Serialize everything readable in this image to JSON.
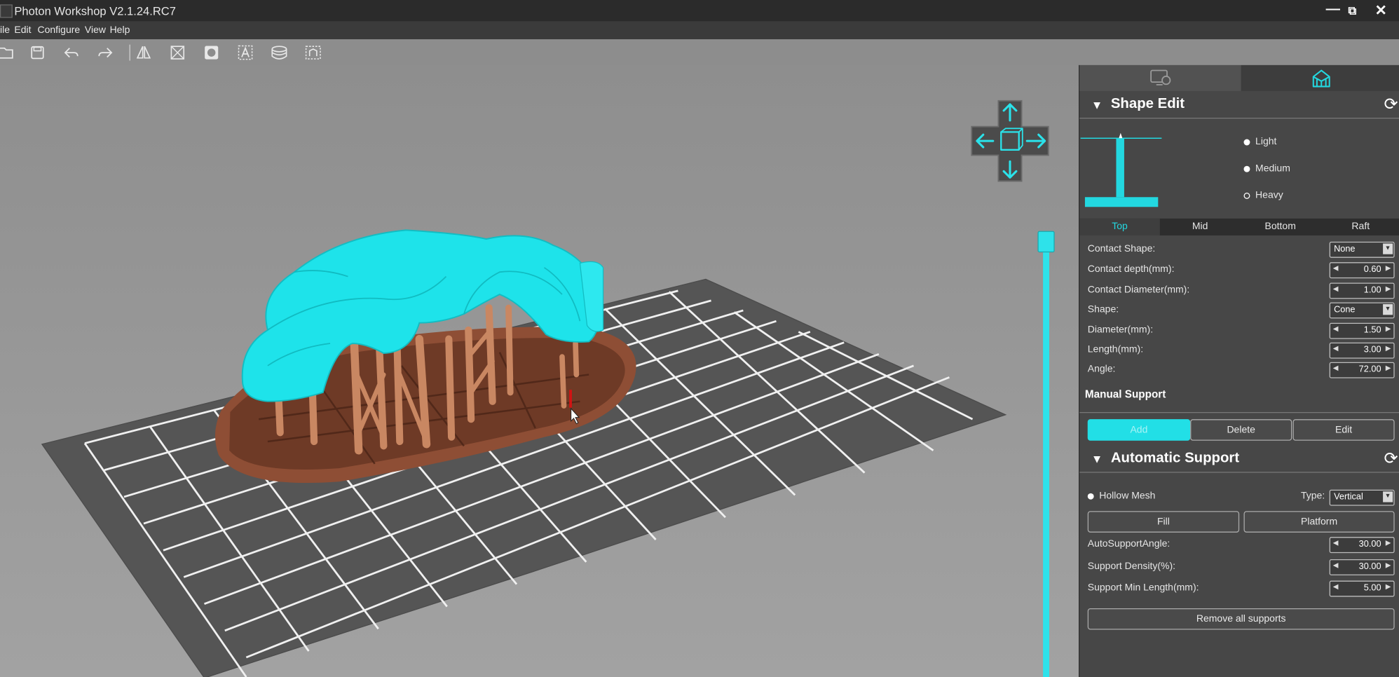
{
  "window": {
    "title": "Photon Workshop V2.1.24.RC7",
    "minimize": "—",
    "restore": "⧉",
    "close": "✕"
  },
  "menu": [
    "ile",
    "Edit",
    "Configure",
    "View",
    "Help"
  ],
  "toolbar_icons": [
    "open-icon",
    "save-icon",
    "undo-icon",
    "redo-icon",
    "mirror-icon",
    "scale-icon",
    "hollow-icon",
    "text-icon",
    "slice-icon",
    "support-icon"
  ],
  "colors": {
    "accent": "#23d8e0",
    "model": "#1ee3ea",
    "support": "#b47552",
    "panel": "#474747",
    "build_plate": "#555555"
  },
  "panel": {
    "tabs": [
      "printer-settings-icon",
      "model-support-icon"
    ],
    "shape_edit": {
      "title": "Shape Edit",
      "presets": [
        {
          "label": "Light",
          "selected": false
        },
        {
          "label": "Medium",
          "selected": false
        },
        {
          "label": "Heavy",
          "selected": true
        }
      ],
      "part_tabs": [
        "Top",
        "Mid",
        "Bottom",
        "Raft"
      ],
      "active_part_tab": "Top",
      "fields": {
        "contact_shape": {
          "label": "Contact Shape:",
          "value": "None"
        },
        "contact_depth": {
          "label": "Contact depth(mm):",
          "value": "0.60"
        },
        "contact_diameter": {
          "label": "Contact Diameter(mm):",
          "value": "1.00"
        },
        "shape": {
          "label": "Shape:",
          "value": "Cone"
        },
        "diameter": {
          "label": "Diameter(mm):",
          "value": "1.50"
        },
        "length": {
          "label": "Length(mm):",
          "value": "3.00"
        },
        "angle": {
          "label": "Angle:",
          "value": "72.00"
        }
      }
    },
    "manual_support": {
      "title": "Manual Support",
      "add": "Add",
      "delete": "Delete",
      "edit": "Edit"
    },
    "automatic_support": {
      "title": "Automatic Support",
      "hollow_mesh": "Hollow Mesh",
      "type_label": "Type:",
      "type_value": "Vertical",
      "fill": "Fill",
      "platform": "Platform",
      "fields": {
        "angle": {
          "label": "AutoSupportAngle:",
          "value": "30.00"
        },
        "density": {
          "label": "Support Density(%):",
          "value": "30.00"
        },
        "min_length": {
          "label": "Support Min Length(mm):",
          "value": "5.00"
        }
      },
      "remove_all": "Remove all supports"
    }
  }
}
